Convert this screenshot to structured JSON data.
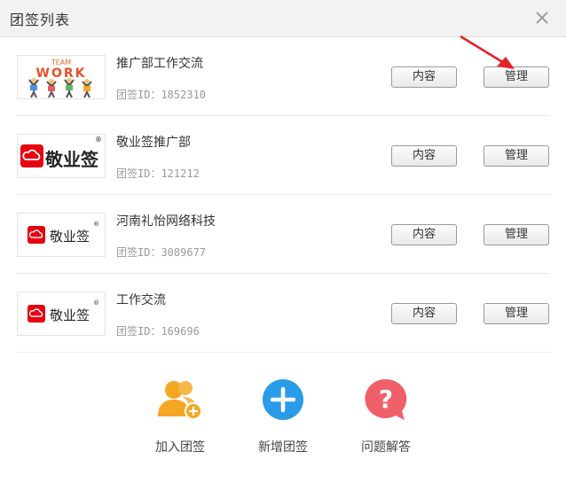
{
  "dialog": {
    "title": "团签列表"
  },
  "teams": [
    {
      "name": "推广部工作交流",
      "id_text": "团签ID：1852310",
      "logo": "team-work-logo",
      "logo_lines": [
        "TEAM",
        "WORK"
      ]
    },
    {
      "name": "敬业签推广部",
      "id_text": "团签ID：121212",
      "logo": "jingyeqian-logo",
      "logo_text": "敬业签"
    },
    {
      "name": "河南礼怡网络科技",
      "id_text": "团签ID：3089677",
      "logo": "jingyeqian-logo",
      "logo_text": "敬业签"
    },
    {
      "name": "工作交流",
      "id_text": "团签ID：169696",
      "logo": "jingyeqian-logo",
      "logo_text": "敬业签"
    }
  ],
  "buttons": {
    "content_label": "内容",
    "manage_label": "管理"
  },
  "actions": [
    {
      "label": "加入团签",
      "icon": "add-user-icon",
      "color": "#f5a623"
    },
    {
      "label": "新增团签",
      "icon": "plus-circle-icon",
      "color": "#2a9be8"
    },
    {
      "label": "问题解答",
      "icon": "question-bubble-icon",
      "color": "#f0606a"
    }
  ],
  "colors": {
    "brand_red": "#e60012",
    "annotation_arrow": "#e8202a"
  }
}
